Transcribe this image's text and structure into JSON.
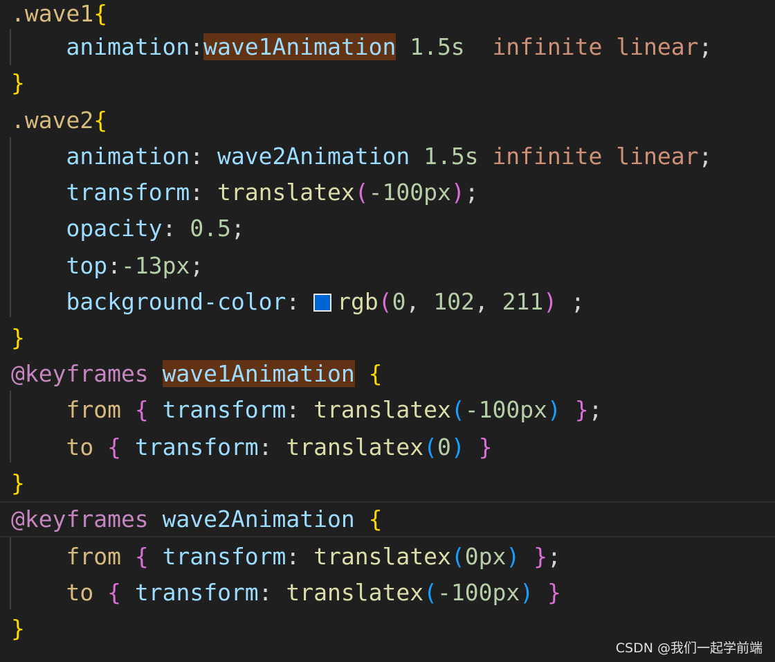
{
  "editor": {
    "color_swatch": "#0066d3",
    "lines": [
      [
        {
          "t": ".wave1",
          "c": "sel"
        },
        {
          "t": "{",
          "c": "b1"
        }
      ],
      [
        {
          "t": "    ",
          "c": "pn"
        },
        {
          "t": "animation",
          "c": "prop"
        },
        {
          "t": ":",
          "c": "pn"
        },
        {
          "t": "wave1Animation",
          "c": "an",
          "hl": true
        },
        {
          "t": " ",
          "c": "pn"
        },
        {
          "t": "1.5s",
          "c": "num"
        },
        {
          "t": "  ",
          "c": "pn"
        },
        {
          "t": "infinite",
          "c": "val"
        },
        {
          "t": " ",
          "c": "pn"
        },
        {
          "t": "linear",
          "c": "val"
        },
        {
          "t": ";",
          "c": "pn"
        }
      ],
      [
        {
          "t": "}",
          "c": "b1"
        }
      ],
      [
        {
          "t": ".wave2",
          "c": "sel"
        },
        {
          "t": "{",
          "c": "b1"
        }
      ],
      [
        {
          "t": "    ",
          "c": "pn"
        },
        {
          "t": "animation",
          "c": "prop"
        },
        {
          "t": ": ",
          "c": "pn"
        },
        {
          "t": "wave2Animation",
          "c": "an"
        },
        {
          "t": " ",
          "c": "pn"
        },
        {
          "t": "1.5s",
          "c": "num"
        },
        {
          "t": " ",
          "c": "pn"
        },
        {
          "t": "infinite",
          "c": "val"
        },
        {
          "t": " ",
          "c": "pn"
        },
        {
          "t": "linear",
          "c": "val"
        },
        {
          "t": ";",
          "c": "pn"
        }
      ],
      [
        {
          "t": "    ",
          "c": "pn"
        },
        {
          "t": "transform",
          "c": "prop"
        },
        {
          "t": ": ",
          "c": "pn"
        },
        {
          "t": "translatex",
          "c": "fn"
        },
        {
          "t": "(",
          "c": "b2"
        },
        {
          "t": "-100px",
          "c": "num"
        },
        {
          "t": ")",
          "c": "b2"
        },
        {
          "t": ";",
          "c": "pn"
        }
      ],
      [
        {
          "t": "    ",
          "c": "pn"
        },
        {
          "t": "opacity",
          "c": "prop"
        },
        {
          "t": ": ",
          "c": "pn"
        },
        {
          "t": "0.5",
          "c": "num"
        },
        {
          "t": ";",
          "c": "pn"
        }
      ],
      [
        {
          "t": "    ",
          "c": "pn"
        },
        {
          "t": "top",
          "c": "prop"
        },
        {
          "t": ":",
          "c": "pn"
        },
        {
          "t": "-13px",
          "c": "num"
        },
        {
          "t": ";",
          "c": "pn"
        }
      ],
      [
        {
          "t": "    ",
          "c": "pn"
        },
        {
          "t": "background-color",
          "c": "prop"
        },
        {
          "t": ": ",
          "c": "pn"
        },
        {
          "swatch": true
        },
        {
          "t": "rgb",
          "c": "fn"
        },
        {
          "t": "(",
          "c": "b2"
        },
        {
          "t": "0",
          "c": "num"
        },
        {
          "t": ", ",
          "c": "pn"
        },
        {
          "t": "102",
          "c": "num"
        },
        {
          "t": ", ",
          "c": "pn"
        },
        {
          "t": "211",
          "c": "num"
        },
        {
          "t": ")",
          "c": "b2"
        },
        {
          "t": " ;",
          "c": "pn"
        }
      ],
      [
        {
          "t": "}",
          "c": "b1"
        }
      ],
      [
        {
          "t": "@keyframes",
          "c": "kw"
        },
        {
          "t": " ",
          "c": "pn"
        },
        {
          "t": "wave1Animation",
          "c": "an",
          "hl": true
        },
        {
          "t": " ",
          "c": "pn"
        },
        {
          "t": "{",
          "c": "b1"
        }
      ],
      [
        {
          "t": "    ",
          "c": "pn"
        },
        {
          "t": "from",
          "c": "sel"
        },
        {
          "t": " ",
          "c": "pn"
        },
        {
          "t": "{",
          "c": "b2"
        },
        {
          "t": " ",
          "c": "pn"
        },
        {
          "t": "transform",
          "c": "prop"
        },
        {
          "t": ": ",
          "c": "pn"
        },
        {
          "t": "translatex",
          "c": "fn"
        },
        {
          "t": "(",
          "c": "b3"
        },
        {
          "t": "-100px",
          "c": "num"
        },
        {
          "t": ")",
          "c": "b3"
        },
        {
          "t": " ",
          "c": "pn"
        },
        {
          "t": "}",
          "c": "b2"
        },
        {
          "t": ";",
          "c": "pn"
        }
      ],
      [
        {
          "t": "    ",
          "c": "pn"
        },
        {
          "t": "to",
          "c": "sel"
        },
        {
          "t": " ",
          "c": "pn"
        },
        {
          "t": "{",
          "c": "b2"
        },
        {
          "t": " ",
          "c": "pn"
        },
        {
          "t": "transform",
          "c": "prop"
        },
        {
          "t": ": ",
          "c": "pn"
        },
        {
          "t": "translatex",
          "c": "fn"
        },
        {
          "t": "(",
          "c": "b3"
        },
        {
          "t": "0",
          "c": "num"
        },
        {
          "t": ")",
          "c": "b3"
        },
        {
          "t": " ",
          "c": "pn"
        },
        {
          "t": "}",
          "c": "b2"
        }
      ],
      [
        {
          "t": "}",
          "c": "b1"
        }
      ],
      [
        {
          "t": "@keyframes",
          "c": "kw"
        },
        {
          "t": " ",
          "c": "pn"
        },
        {
          "t": "wave2Animation",
          "c": "an"
        },
        {
          "t": " ",
          "c": "pn"
        },
        {
          "t": "{",
          "c": "b1"
        }
      ],
      [
        {
          "t": "    ",
          "c": "pn"
        },
        {
          "t": "from",
          "c": "sel"
        },
        {
          "t": " ",
          "c": "pn"
        },
        {
          "t": "{",
          "c": "b2"
        },
        {
          "t": " ",
          "c": "pn"
        },
        {
          "t": "transform",
          "c": "prop"
        },
        {
          "t": ": ",
          "c": "pn"
        },
        {
          "t": "translatex",
          "c": "fn"
        },
        {
          "t": "(",
          "c": "b3"
        },
        {
          "t": "0px",
          "c": "num"
        },
        {
          "t": ")",
          "c": "b3"
        },
        {
          "t": " ",
          "c": "pn"
        },
        {
          "t": "}",
          "c": "b2"
        },
        {
          "t": ";",
          "c": "pn"
        }
      ],
      [
        {
          "t": "    ",
          "c": "pn"
        },
        {
          "t": "to",
          "c": "sel"
        },
        {
          "t": " ",
          "c": "pn"
        },
        {
          "t": "{",
          "c": "b2"
        },
        {
          "t": " ",
          "c": "pn"
        },
        {
          "t": "transform",
          "c": "prop"
        },
        {
          "t": ": ",
          "c": "pn"
        },
        {
          "t": "translatex",
          "c": "fn"
        },
        {
          "t": "(",
          "c": "b3"
        },
        {
          "t": "-100px",
          "c": "num"
        },
        {
          "t": ")",
          "c": "b3"
        },
        {
          "t": " ",
          "c": "pn"
        },
        {
          "t": "}",
          "c": "b2"
        }
      ],
      [
        {
          "t": "}",
          "c": "b1"
        }
      ]
    ]
  },
  "watermark": "CSDN @我们一起学前端"
}
